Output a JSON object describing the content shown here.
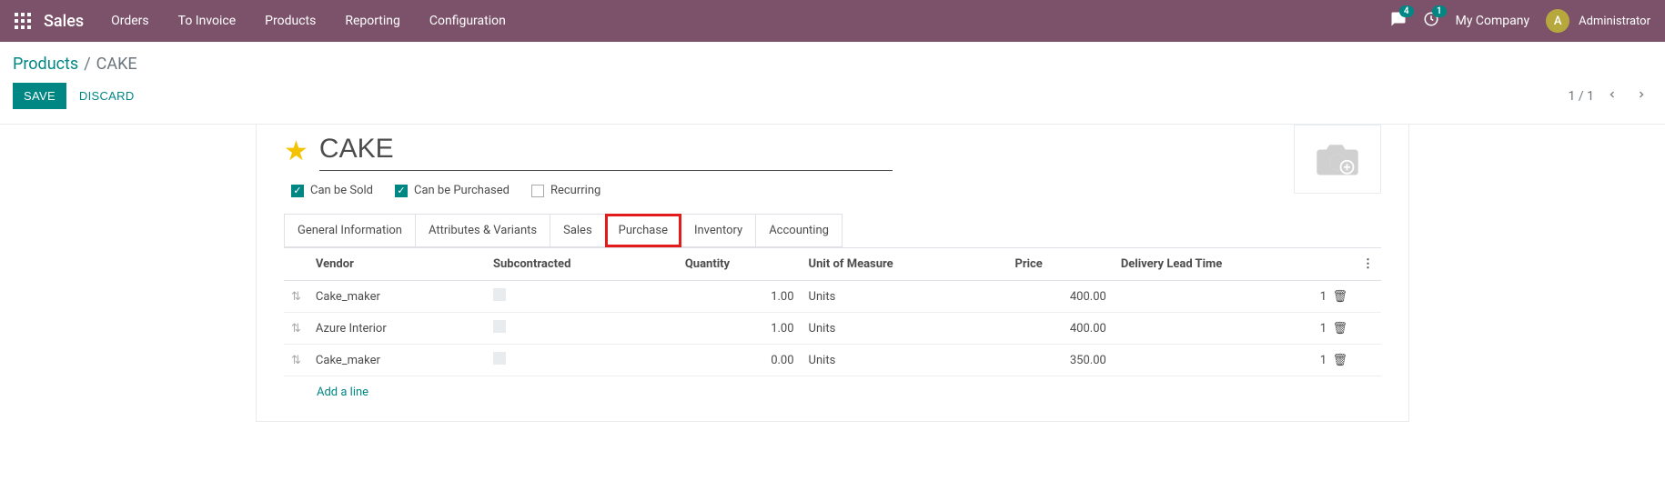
{
  "nav": {
    "brand": "Sales",
    "links": [
      "Orders",
      "To Invoice",
      "Products",
      "Reporting",
      "Configuration"
    ],
    "msg_badge": "4",
    "activity_badge": "1",
    "company": "My Company",
    "user_initial": "A",
    "user_name": "Administrator"
  },
  "breadcrumb": {
    "parent": "Products",
    "current": "CAKE"
  },
  "toolbar": {
    "save": "SAVE",
    "discard": "DISCARD",
    "pager": "1 / 1"
  },
  "product": {
    "name": "CAKE",
    "can_be_sold": "Can be Sold",
    "can_be_purchased": "Can be Purchased",
    "recurring": "Recurring"
  },
  "tabs": [
    "General Information",
    "Attributes & Variants",
    "Sales",
    "Purchase",
    "Inventory",
    "Accounting"
  ],
  "table": {
    "headers": {
      "vendor": "Vendor",
      "subcontracted": "Subcontracted",
      "quantity": "Quantity",
      "uom": "Unit of Measure",
      "price": "Price",
      "lead": "Delivery Lead Time"
    },
    "rows": [
      {
        "vendor": "Cake_maker",
        "qty": "1.00",
        "uom": "Units",
        "price": "400.00",
        "lead": "1"
      },
      {
        "vendor": "Azure Interior",
        "qty": "1.00",
        "uom": "Units",
        "price": "400.00",
        "lead": "1"
      },
      {
        "vendor": "Cake_maker",
        "qty": "0.00",
        "uom": "Units",
        "price": "350.00",
        "lead": "1"
      }
    ],
    "add_line": "Add a line"
  }
}
